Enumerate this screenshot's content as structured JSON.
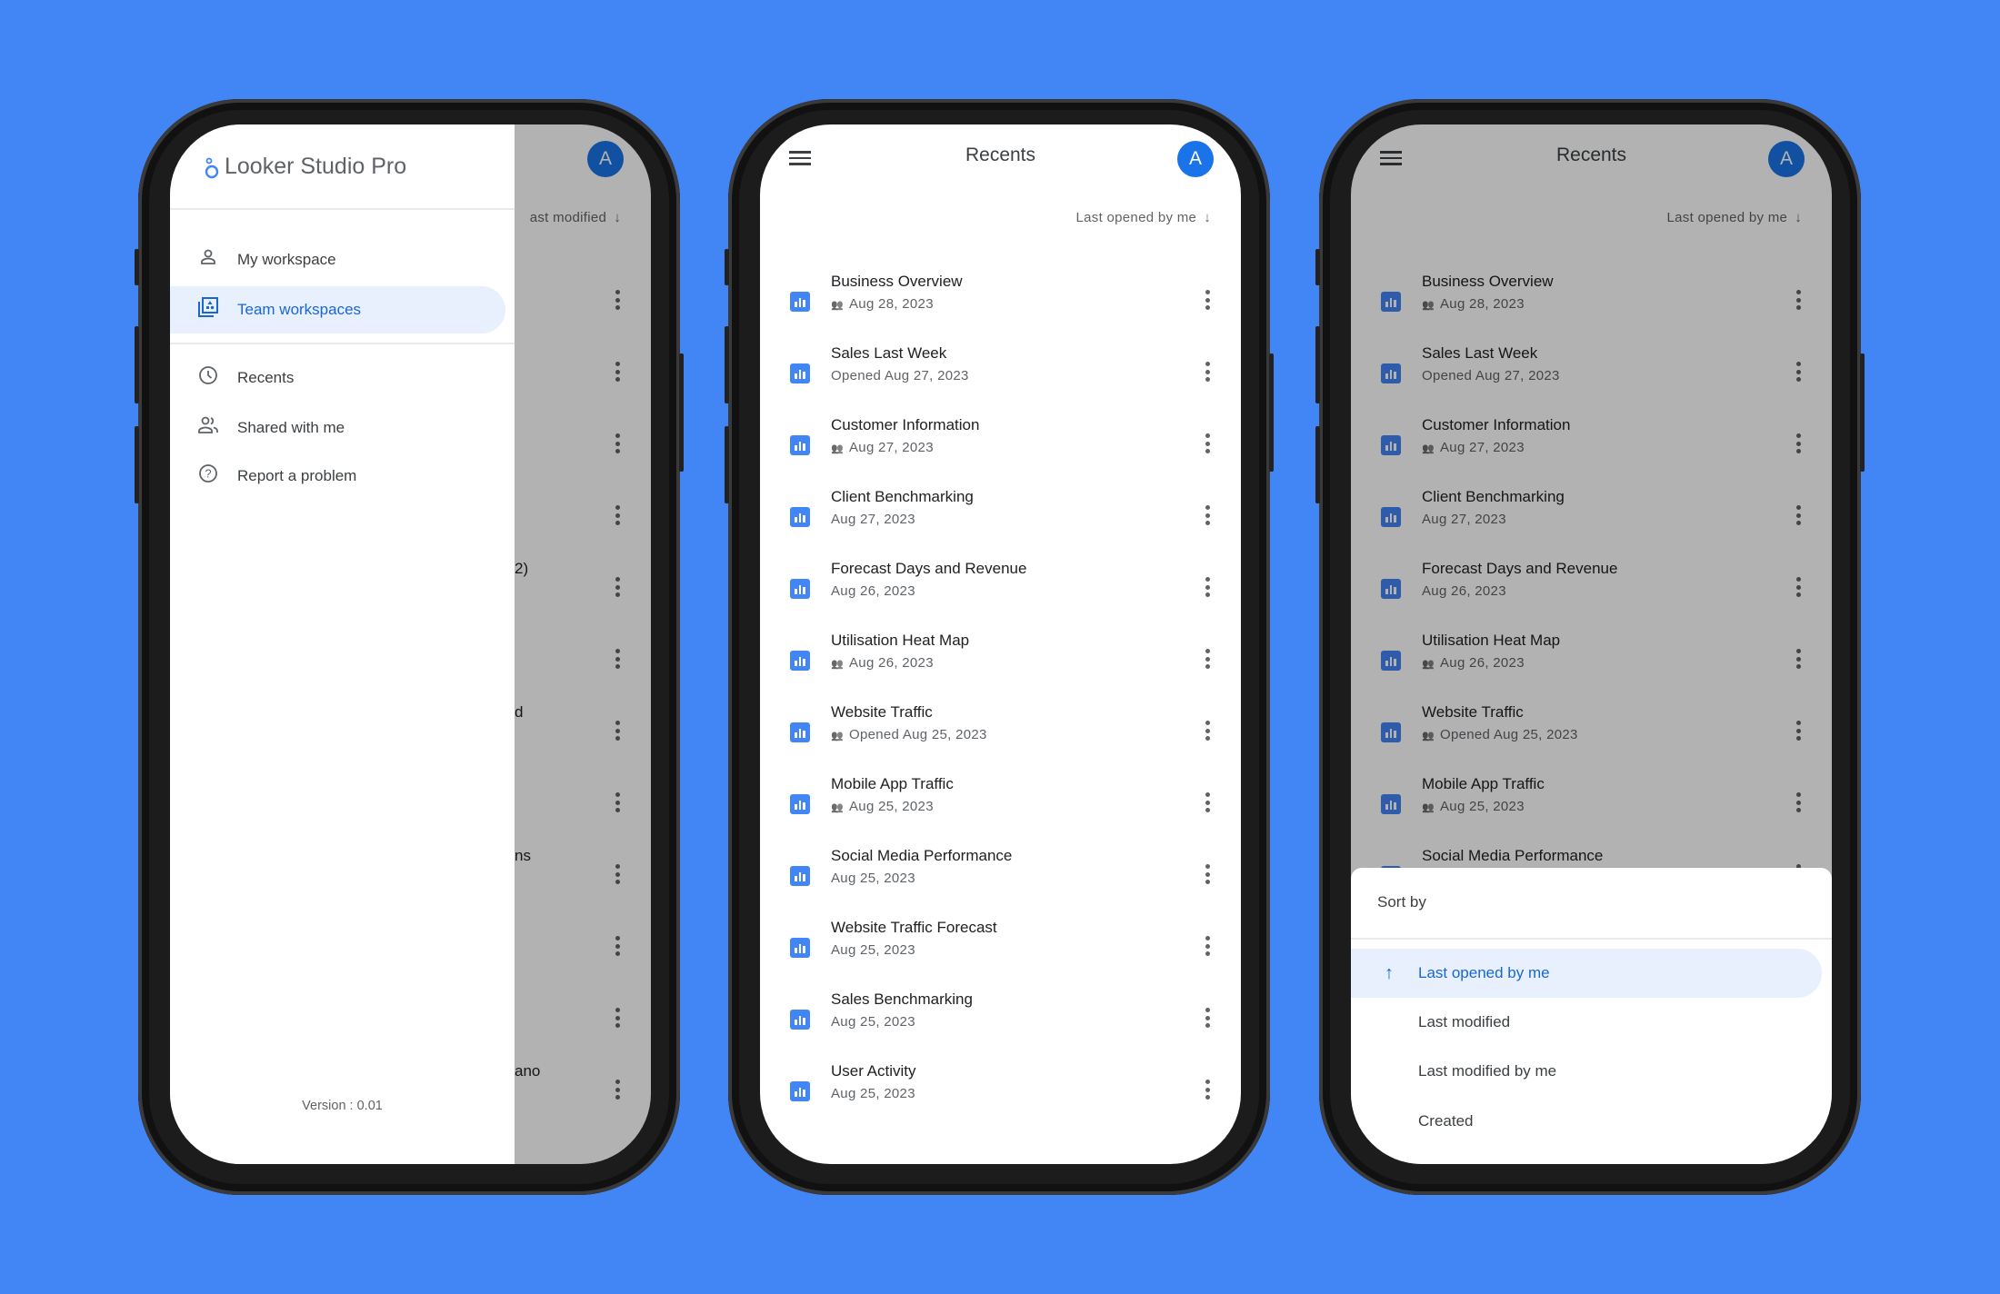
{
  "colors": {
    "background": "#4285f4",
    "accent": "#1a73e8",
    "report_icon": "#4285f4",
    "active_bg": "#e8f0fe"
  },
  "drawer_phone": {
    "avatar": "A",
    "sort_label": "Last modified",
    "sort_label_visible": "ast modified",
    "drawer": {
      "logo_text": "Looker Studio Pro",
      "items": [
        {
          "label": "My workspace",
          "icon": "person-icon",
          "active": false
        },
        {
          "label": "Team workspaces",
          "icon": "team-workspace-icon",
          "active": true
        },
        {
          "label": "Recents",
          "icon": "clock-icon",
          "active": false
        },
        {
          "label": "Shared with me",
          "icon": "people-icon",
          "active": false
        },
        {
          "label": "Report a problem",
          "icon": "help-circle-icon",
          "active": false
        }
      ],
      "version": "Version : 0.01"
    },
    "row_fragments": [
      "",
      "",
      "",
      "",
      "2)",
      "",
      "d",
      "",
      "ns",
      "",
      "",
      "ano"
    ]
  },
  "recents": {
    "menu_icon": "hamburger-icon",
    "title": "Recents",
    "avatar": "A",
    "sort_label": "Last opened by me",
    "sort_direction": "down-arrow-icon",
    "items": [
      {
        "title": "Business Overview",
        "subtitle": "Aug 28, 2023",
        "shared": true
      },
      {
        "title": "Sales Last Week",
        "subtitle": "Opened Aug 27, 2023",
        "shared": false
      },
      {
        "title": "Customer Information",
        "subtitle": "Aug 27, 2023",
        "shared": true
      },
      {
        "title": "Client Benchmarking",
        "subtitle": "Aug 27, 2023",
        "shared": false
      },
      {
        "title": "Forecast Days and Revenue",
        "subtitle": "Aug 26, 2023",
        "shared": false
      },
      {
        "title": "Utilisation Heat Map",
        "subtitle": "Aug 26, 2023",
        "shared": true
      },
      {
        "title": "Website Traffic",
        "subtitle": "Opened Aug 25, 2023",
        "shared": true
      },
      {
        "title": "Mobile App Traffic",
        "subtitle": "Aug 25, 2023",
        "shared": true
      },
      {
        "title": "Social Media Performance",
        "subtitle": "Aug 25, 2023",
        "shared": false
      },
      {
        "title": "Website Traffic Forecast",
        "subtitle": "Aug 25, 2023",
        "shared": false
      },
      {
        "title": "Sales Benchmarking",
        "subtitle": "Aug 25, 2023",
        "shared": false
      },
      {
        "title": "User Activity",
        "subtitle": "Aug 25, 2023",
        "shared": false
      }
    ]
  },
  "sort_sheet": {
    "title": "Sort by",
    "options": [
      {
        "label": "Last opened by me",
        "selected": true,
        "icon": "up-arrow-icon"
      },
      {
        "label": "Last modified",
        "selected": false
      },
      {
        "label": "Last modified by me",
        "selected": false
      },
      {
        "label": "Created",
        "selected": false
      }
    ]
  }
}
